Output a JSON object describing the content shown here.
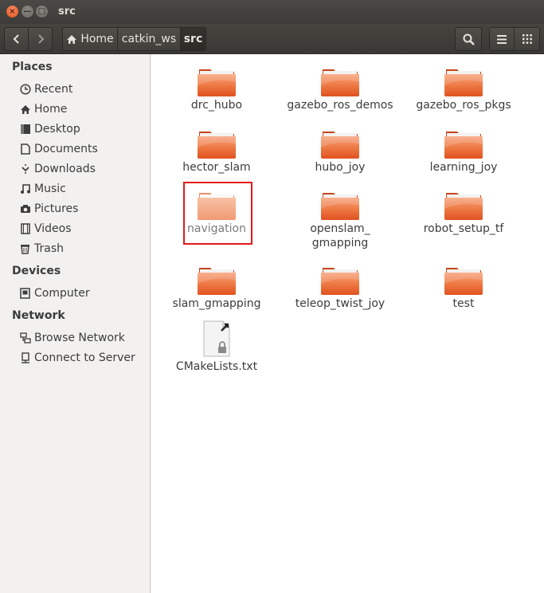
{
  "window": {
    "title": "src"
  },
  "titlebar": {
    "close": "×",
    "minimize": "—",
    "maximize": "□"
  },
  "breadcrumb": {
    "home": "Home",
    "catkin": "catkin_ws",
    "current": "src"
  },
  "sidebar": {
    "places_heading": "Places",
    "places": [
      {
        "label": "Recent",
        "icon": "clock-icon"
      },
      {
        "label": "Home",
        "icon": "home-icon"
      },
      {
        "label": "Desktop",
        "icon": "desktop-icon"
      },
      {
        "label": "Documents",
        "icon": "document-icon"
      },
      {
        "label": "Downloads",
        "icon": "download-icon"
      },
      {
        "label": "Music",
        "icon": "music-icon"
      },
      {
        "label": "Pictures",
        "icon": "camera-icon"
      },
      {
        "label": "Videos",
        "icon": "film-icon"
      },
      {
        "label": "Trash",
        "icon": "trash-icon"
      }
    ],
    "devices_heading": "Devices",
    "devices": [
      {
        "label": "Computer",
        "icon": "computer-icon"
      }
    ],
    "network_heading": "Network",
    "network": [
      {
        "label": "Browse Network",
        "icon": "network-icon"
      },
      {
        "label": "Connect to Server",
        "icon": "server-icon"
      }
    ]
  },
  "files": [
    {
      "label": "drc_hubo",
      "type": "folder"
    },
    {
      "label": "gazebo_ros_demos",
      "type": "folder"
    },
    {
      "label": "gazebo_ros_pkgs",
      "type": "folder"
    },
    {
      "label": "hector_slam",
      "type": "folder"
    },
    {
      "label": "hubo_joy",
      "type": "folder"
    },
    {
      "label": "learning_joy",
      "type": "folder"
    },
    {
      "label": "navigation",
      "type": "folder",
      "selected": true
    },
    {
      "label": "openslam_",
      "label2": "gmapping",
      "type": "folder"
    },
    {
      "label": "robot_setup_tf",
      "type": "folder"
    },
    {
      "label": "slam_gmapping",
      "type": "folder"
    },
    {
      "label": "teleop_twist_joy",
      "type": "folder"
    },
    {
      "label": "test",
      "type": "folder"
    },
    {
      "label": "CMakeLists.txt",
      "type": "file"
    }
  ],
  "colors": {
    "folder_top": "#f6a27a",
    "folder_bottom": "#e2531e",
    "highlight": "#e4181b"
  }
}
